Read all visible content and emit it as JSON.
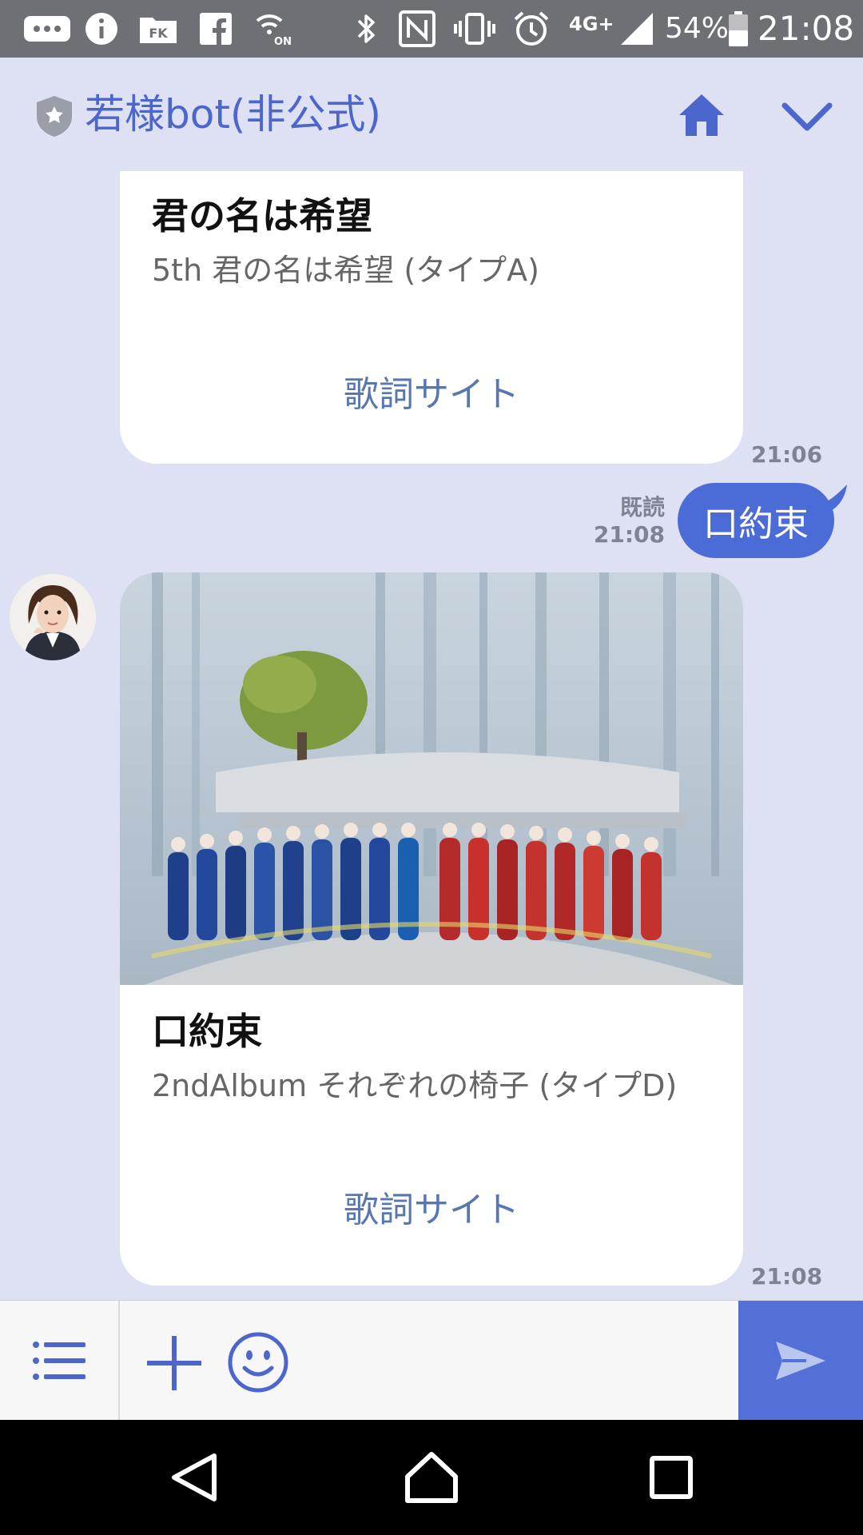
{
  "status_bar": {
    "network": "4G+",
    "battery": "54%",
    "time": "21:08",
    "icons": [
      "more-icon",
      "info-icon",
      "fk-icon",
      "facebook-icon",
      "wifi-calling-icon",
      "bluetooth-icon",
      "nfc-icon",
      "vibrate-icon",
      "alarm-icon",
      "signal-icon",
      "battery-icon"
    ],
    "fk_label": "FK",
    "wifi_label": "ON"
  },
  "header": {
    "title": "若様bot(非公式)",
    "icons": [
      "shield-icon",
      "home-icon",
      "chevron-down-icon"
    ]
  },
  "messages": [
    {
      "type": "card",
      "title": "君の名は希望",
      "subtitle": "5th 君の名は希望 (タイプA)",
      "link": "歌詞サイト",
      "time": "21:06"
    },
    {
      "type": "outgoing",
      "text": "口約束",
      "read_label": "既読",
      "time": "21:08"
    },
    {
      "type": "card",
      "title": "口約束",
      "subtitle": "2ndAlbum それぞれの椅子 (タイプD)",
      "link": "歌詞サイト",
      "time": "21:08"
    }
  ],
  "input_bar": {
    "placeholder": "",
    "icons": [
      "menu-icon",
      "plus-icon",
      "emoji-icon",
      "send-icon"
    ]
  },
  "nav_bar": {
    "icons": [
      "back-icon",
      "home-nav-icon",
      "recents-icon"
    ]
  },
  "colors": {
    "status_bar": "#6f6f76",
    "background": "#dde1f3",
    "accent": "#4d66cc",
    "bubble": "#4b6bd7",
    "link": "#5877b0",
    "send_button": "#5370d8"
  }
}
